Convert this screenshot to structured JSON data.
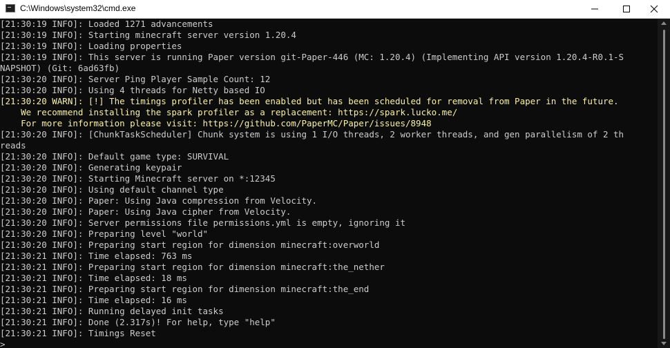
{
  "window": {
    "title": "C:\\Windows\\system32\\cmd.exe",
    "icon": "console-app-icon"
  },
  "controls": {
    "minimize_icon": "minimize-icon",
    "maximize_icon": "maximize-icon",
    "close_icon": "close-icon"
  },
  "colors": {
    "background": "#0c0c0c",
    "text": "#cccccc",
    "warn_text": "#f9f1a5",
    "titlebar": "#ffffff"
  },
  "console": {
    "lines": [
      {
        "text": "[21:30:19 INFO]: Loaded 1271 advancements",
        "level": "info"
      },
      {
        "text": "[21:30:19 INFO]: Starting minecraft server version 1.20.4",
        "level": "info"
      },
      {
        "text": "[21:30:19 INFO]: Loading properties",
        "level": "info"
      },
      {
        "text": "[21:30:19 INFO]: This server is running Paper version git-Paper-446 (MC: 1.20.4) (Implementing API version 1.20.4-R0.1-S",
        "level": "info"
      },
      {
        "text": "NAPSHOT) (Git: 6ad63fb)",
        "level": "info"
      },
      {
        "text": "[21:30:20 INFO]: Server Ping Player Sample Count: 12",
        "level": "info"
      },
      {
        "text": "[21:30:20 INFO]: Using 4 threads for Netty based IO",
        "level": "info"
      },
      {
        "text": "[21:30:20 WARN]: [!] The timings profiler has been enabled but has been scheduled for removal from Paper in the future.",
        "level": "warn"
      },
      {
        "text": "    We recommend installing the spark profiler as a replacement: https://spark.lucko.me/",
        "level": "warn"
      },
      {
        "text": "    For more information please visit: https://github.com/PaperMC/Paper/issues/8948",
        "level": "warn"
      },
      {
        "text": "[21:30:20 INFO]: [ChunkTaskScheduler] Chunk system is using 1 I/O threads, 2 worker threads, and gen parallelism of 2 th",
        "level": "info"
      },
      {
        "text": "reads",
        "level": "info"
      },
      {
        "text": "[21:30:20 INFO]: Default game type: SURVIVAL",
        "level": "info"
      },
      {
        "text": "[21:30:20 INFO]: Generating keypair",
        "level": "info"
      },
      {
        "text": "[21:30:20 INFO]: Starting Minecraft server on *:12345",
        "level": "info"
      },
      {
        "text": "[21:30:20 INFO]: Using default channel type",
        "level": "info"
      },
      {
        "text": "[21:30:20 INFO]: Paper: Using Java compression from Velocity.",
        "level": "info"
      },
      {
        "text": "[21:30:20 INFO]: Paper: Using Java cipher from Velocity.",
        "level": "info"
      },
      {
        "text": "[21:30:20 INFO]: Server permissions file permissions.yml is empty, ignoring it",
        "level": "info"
      },
      {
        "text": "[21:30:20 INFO]: Preparing level \"world\"",
        "level": "info"
      },
      {
        "text": "[21:30:20 INFO]: Preparing start region for dimension minecraft:overworld",
        "level": "info"
      },
      {
        "text": "[21:30:21 INFO]: Time elapsed: 763 ms",
        "level": "info"
      },
      {
        "text": "[21:30:21 INFO]: Preparing start region for dimension minecraft:the_nether",
        "level": "info"
      },
      {
        "text": "[21:30:21 INFO]: Time elapsed: 18 ms",
        "level": "info"
      },
      {
        "text": "[21:30:21 INFO]: Preparing start region for dimension minecraft:the_end",
        "level": "info"
      },
      {
        "text": "[21:30:21 INFO]: Time elapsed: 16 ms",
        "level": "info"
      },
      {
        "text": "[21:30:21 INFO]: Running delayed init tasks",
        "level": "info"
      },
      {
        "text": "[21:30:21 INFO]: Done (2.317s)! For help, type \"help\"",
        "level": "info"
      },
      {
        "text": "[21:30:21 INFO]: Timings Reset",
        "level": "info"
      }
    ],
    "prompt": "> _"
  }
}
